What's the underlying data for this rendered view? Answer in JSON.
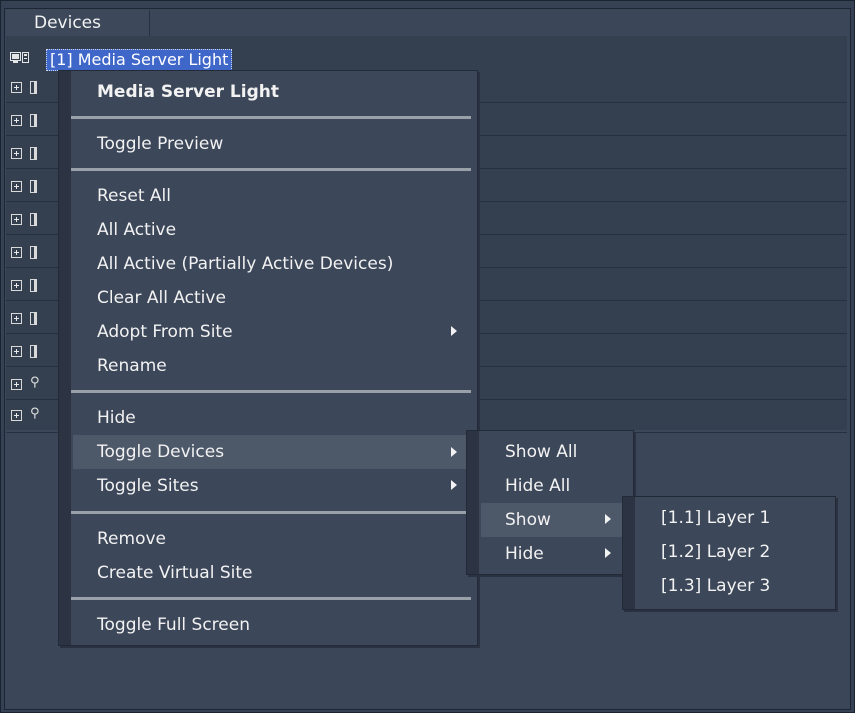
{
  "panel": {
    "tab_label": "Devices"
  },
  "tree": {
    "root_label": "[1] Media Server Light",
    "rows": [
      {
        "kind": "device"
      },
      {
        "kind": "device"
      },
      {
        "kind": "device"
      },
      {
        "kind": "device"
      },
      {
        "kind": "device"
      },
      {
        "kind": "device"
      },
      {
        "kind": "device"
      },
      {
        "kind": "device"
      },
      {
        "kind": "device"
      },
      {
        "kind": "site"
      },
      {
        "kind": "site"
      }
    ]
  },
  "context_menu": {
    "title": "Media Server Light",
    "items": {
      "toggle_preview": "Toggle Preview",
      "reset_all": "Reset All",
      "all_active": "All Active",
      "all_active_partial": "All Active (Partially Active Devices)",
      "clear_all_active": "Clear All Active",
      "adopt_from_site": "Adopt From Site",
      "rename": "Rename",
      "hide": "Hide",
      "toggle_devices": "Toggle Devices",
      "toggle_sites": "Toggle Sites",
      "remove": "Remove",
      "create_virtual_site": "Create Virtual Site",
      "toggle_full_screen": "Toggle Full Screen"
    }
  },
  "toggle_devices_submenu": {
    "show_all": "Show All",
    "hide_all": "Hide All",
    "show": "Show",
    "hide": "Hide"
  },
  "show_submenu": {
    "layers": [
      "[1.1] Layer 1",
      "[1.2] Layer 2",
      "[1.3] Layer 3"
    ]
  }
}
